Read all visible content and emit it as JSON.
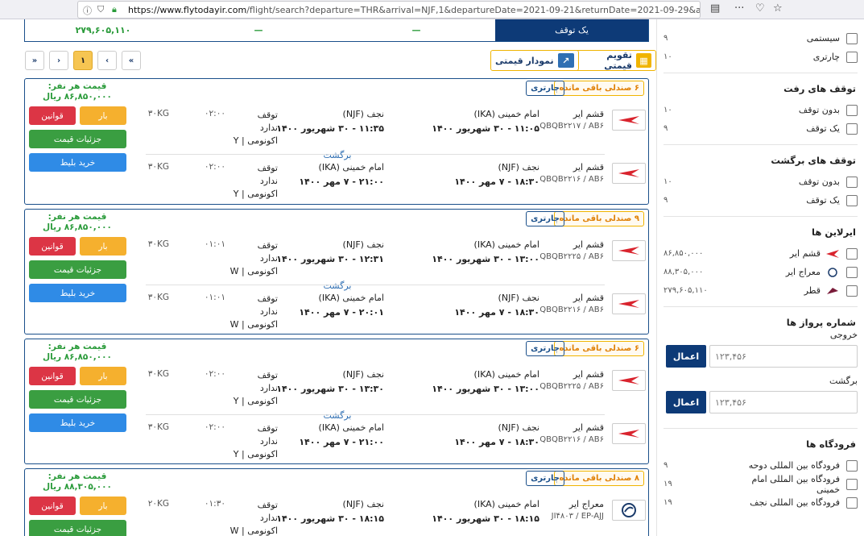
{
  "browser": {
    "url_host": "https://www.flytodayir.com",
    "url_path": "/flight/search?departure=THR&arrival=NJF,1&departureDate=2021-09-21&returnDate=2021-09-29&adt=1"
  },
  "summary_bar": {
    "active_tab": "یک توقف",
    "dash1": "—",
    "dash2": "—",
    "price": "۲۷۹,۶۰۵,۱۱۰"
  },
  "pager": {
    "first": "«",
    "prev": "‹",
    "current": "۱",
    "next": "›",
    "last": "»"
  },
  "tools": {
    "price_calendar": "تقویم قیمتی",
    "price_chart": "نمودار قیمتی"
  },
  "results": [
    {
      "seats": "۶ صندلی باقی مانده",
      "type": "چارتری",
      "price_label": "قیمت هر نفر:",
      "price": "۸۶,۸۵۰,۰۰۰ ریال",
      "buttons": {
        "baggage": "بار",
        "rules": "قوانین",
        "details": "جزئیات قیمت",
        "buy": "خرید بلیط"
      },
      "return_label": "برگشت",
      "legs": [
        {
          "airline": "قشم ایر",
          "flight": "QBQB۲۲۱۷ / AB۶",
          "dep_city": "امام خمینی (IKA)",
          "dep_time": "۱۱:۰۵ - ۳۰ شهریور ۱۴۰۰",
          "arr_city": "نجف (NJF)",
          "arr_time": "۱۱:۳۵ - ۳۰ شهریور ۱۴۰۰",
          "stop": "توقف",
          "stop2": "ندارد",
          "class": "اکونومی | Y",
          "duration": "۰۲:۰۰",
          "baggage": "۳۰KG"
        },
        {
          "airline": "قشم ایر",
          "flight": "QBQB۲۲۱۶ / AB۶",
          "dep_city": "نجف (NJF)",
          "dep_time": "۱۸:۳۰ - ۷ مهر ۱۴۰۰",
          "arr_city": "امام خمینی (IKA)",
          "arr_time": "۲۱:۰۰ - ۷ مهر ۱۴۰۰",
          "stop": "توقف",
          "stop2": "ندارد",
          "class": "اکونومی | Y",
          "duration": "۰۲:۰۰",
          "baggage": "۳۰KG"
        }
      ]
    },
    {
      "seats": "۹ صندلی باقی مانده",
      "type": "چارتری",
      "price_label": "قیمت هر نفر:",
      "price": "۸۶,۸۵۰,۰۰۰ ریال",
      "buttons": {
        "baggage": "بار",
        "rules": "قوانین",
        "details": "جزئیات قیمت",
        "buy": "خرید بلیط"
      },
      "return_label": "برگشت",
      "legs": [
        {
          "airline": "قشم ایر",
          "flight": "QBQB۲۲۲۵ / AB۶",
          "dep_city": "امام خمینی (IKA)",
          "dep_time": "۱۳:۰۰ - ۳۰ شهریور ۱۴۰۰",
          "arr_city": "نجف (NJF)",
          "arr_time": "۱۲:۳۱ - ۳۰ شهریور ۱۴۰۰",
          "stop": "توقف",
          "stop2": "ندارد",
          "class": "اکونومی | W",
          "duration": "۰۱:۰۱",
          "baggage": "۳۰KG"
        },
        {
          "airline": "قشم ایر",
          "flight": "QBQB۲۲۱۶ / AB۶",
          "dep_city": "نجف (NJF)",
          "dep_time": "۱۸:۳۰ - ۷ مهر ۱۴۰۰",
          "arr_city": "امام خمینی (IKA)",
          "arr_time": "۲۰:۰۱ - ۷ مهر ۱۴۰۰",
          "stop": "توقف",
          "stop2": "ندارد",
          "class": "اکونومی | W",
          "duration": "۰۱:۰۱",
          "baggage": "۳۰KG"
        }
      ]
    },
    {
      "seats": "۶ صندلی باقی مانده",
      "type": "چارتری",
      "price_label": "قیمت هر نفر:",
      "price": "۸۶,۸۵۰,۰۰۰ ریال",
      "buttons": {
        "baggage": "بار",
        "rules": "قوانین",
        "details": "جزئیات قیمت",
        "buy": "خرید بلیط"
      },
      "return_label": "برگشت",
      "legs": [
        {
          "airline": "قشم ایر",
          "flight": "QBQB۲۲۲۵ / AB۶",
          "dep_city": "امام خمینی (IKA)",
          "dep_time": "۱۳:۰۰ - ۳۰ شهریور ۱۴۰۰",
          "arr_city": "نجف (NJF)",
          "arr_time": "۱۳:۳۰ - ۳۰ شهریور ۱۴۰۰",
          "stop": "توقف",
          "stop2": "ندارد",
          "class": "اکونومی | Y",
          "duration": "۰۲:۰۰",
          "baggage": "۳۰KG"
        },
        {
          "airline": "قشم ایر",
          "flight": "QBQB۲۲۱۶ / AB۶",
          "dep_city": "نجف (NJF)",
          "dep_time": "۱۸:۳۰ - ۷ مهر ۱۴۰۰",
          "arr_city": "امام خمینی (IKA)",
          "arr_time": "۲۱:۰۰ - ۷ مهر ۱۴۰۰",
          "stop": "توقف",
          "stop2": "ندارد",
          "class": "اکونومی | Y",
          "duration": "۰۲:۰۰",
          "baggage": "۳۰KG"
        }
      ]
    },
    {
      "seats": "۸ صندلی باقی مانده",
      "type": "چارتری",
      "price_label": "قیمت هر نفر:",
      "price": "۸۸,۳۰۵,۰۰۰ ریال",
      "buttons": {
        "baggage": "بار",
        "rules": "قوانین",
        "details": "جزئیات قیمت",
        "buy": "خرید بلیط"
      },
      "return_label": "برگشت",
      "legs": [
        {
          "airline": "معراج ایر",
          "flight": "JI۴۸۰۳ / EP-AJJ",
          "dep_city": "امام خمینی (IKA)",
          "dep_time": "۱۸:۱۵ - ۳۰ شهریور ۱۴۰۰",
          "arr_city": "نجف (NJF)",
          "arr_time": "۱۸:۱۵ - ۳۰ شهریور ۱۴۰۰",
          "stop": "توقف",
          "stop2": "ندارد",
          "class": "اکونومی | W",
          "duration": "۰۱:۳۰",
          "baggage": "۲۰KG"
        }
      ]
    }
  ],
  "filters": {
    "ticket_type": [
      {
        "label": "سیستمی",
        "count": "۹"
      },
      {
        "label": "چارتری",
        "count": "۱۰"
      }
    ],
    "outbound_stops": {
      "title": "توقف های رفت",
      "items": [
        {
          "label": "بدون توقف",
          "count": "۱۰"
        },
        {
          "label": "یک توقف",
          "count": "۹"
        }
      ]
    },
    "return_stops": {
      "title": "توقف های برگشت",
      "items": [
        {
          "label": "بدون توقف",
          "count": "۱۰"
        },
        {
          "label": "یک توقف",
          "count": "۹"
        }
      ]
    },
    "airlines": {
      "title": "ایرلاین ها",
      "items": [
        {
          "label": "قشم ایر",
          "count": "۸۶,۸۵۰,۰۰۰",
          "logo": "qeshm"
        },
        {
          "label": "معراج ایر",
          "count": "۸۸,۳۰۵,۰۰۰",
          "logo": "meraj"
        },
        {
          "label": "قطر",
          "count": "۲۷۹,۶۰۵,۱۱۰",
          "logo": "qatar"
        }
      ]
    },
    "flight_number": {
      "title": "شماره پرواز ها",
      "outbound_label": "خروجی",
      "return_label": "برگشت",
      "placeholder": "۱۲۳,۴۵۶",
      "apply": "اعمال"
    },
    "airports": {
      "title": "فرودگاه ها",
      "items": [
        {
          "label": "فرودگاه بین المللی دوحه",
          "count": "۹"
        },
        {
          "label": "فرودگاه بین المللی امام خمینی",
          "count": "۱۹"
        },
        {
          "label": "فرودگاه بین المللی نجف",
          "count": "۱۹"
        }
      ]
    }
  },
  "colors": {
    "navy": "#0d3a77",
    "green": "#2a9b3a",
    "red": "#dc3545",
    "orange": "#f5b02e",
    "blue": "#2f8be6"
  }
}
